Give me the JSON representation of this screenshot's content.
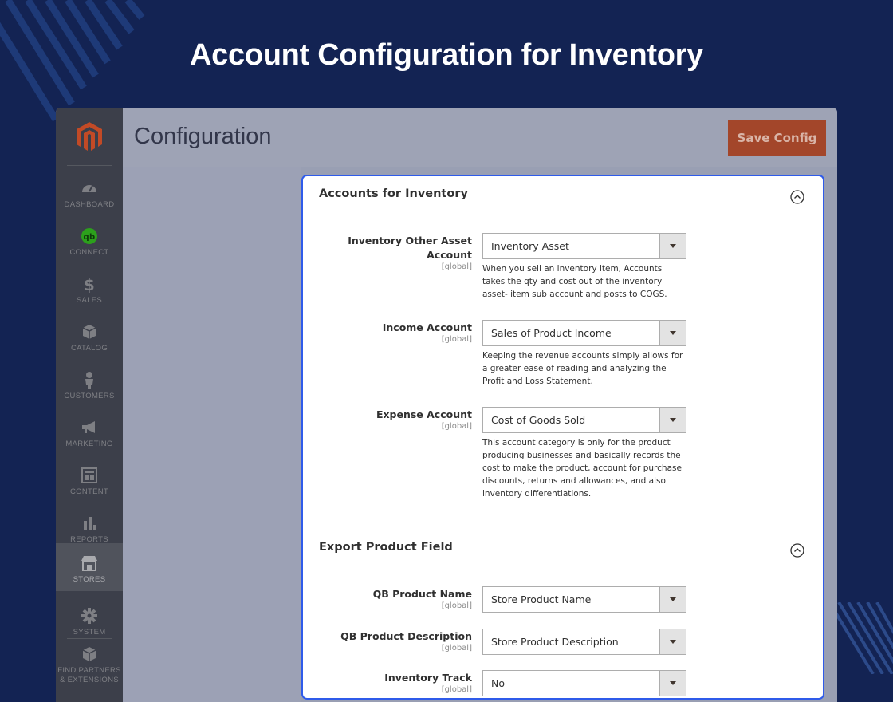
{
  "hero": {
    "title": "Account Configuration for Inventory"
  },
  "colors": {
    "background": "#132353",
    "panel_border": "#2f5bea",
    "save_button": "#a3462a",
    "sidebar": "#3c3f4a"
  },
  "sidebar": {
    "logo": "magento-logo",
    "items": [
      {
        "label": "DASHBOARD",
        "icon": "dashboard-icon",
        "active": false
      },
      {
        "label": "CONNECT",
        "icon": "quickbooks-icon",
        "active": false
      },
      {
        "label": "SALES",
        "icon": "dollar-icon",
        "active": false
      },
      {
        "label": "CATALOG",
        "icon": "box-icon",
        "active": false
      },
      {
        "label": "CUSTOMERS",
        "icon": "person-icon",
        "active": false
      },
      {
        "label": "MARKETING",
        "icon": "megaphone-icon",
        "active": false
      },
      {
        "label": "CONTENT",
        "icon": "layout-icon",
        "active": false
      },
      {
        "label": "REPORTS",
        "icon": "bar-chart-icon",
        "active": false
      },
      {
        "label": "STORES",
        "icon": "storefront-icon",
        "active": true
      },
      {
        "label": "SYSTEM",
        "icon": "gear-icon",
        "active": false
      },
      {
        "label": "FIND PARTNERS",
        "label2": "& EXTENSIONS",
        "icon": "cube-icon",
        "active": false
      }
    ]
  },
  "header": {
    "title": "Configuration",
    "save_label": "Save Config"
  },
  "sections": [
    {
      "title": "Accounts for Inventory",
      "fields": [
        {
          "label_line1": "Inventory Other Asset",
          "label_line2": "Account",
          "scope": "[global]",
          "value": "Inventory Asset",
          "note_lines": [
            "When you sell an inventory item, Accounts",
            "takes the qty and cost out of the inventory",
            "asset- item sub account and posts to COGS."
          ]
        },
        {
          "label_line1": "Income Account",
          "scope": "[global]",
          "value": "Sales of Product Income",
          "note_lines": [
            "Keeping the revenue accounts simply allows for",
            "a greater ease of reading and analyzing the",
            "Profit and Loss Statement."
          ]
        },
        {
          "label_line1": "Expense Account",
          "scope": "[global]",
          "value": "Cost of Goods Sold",
          "note_lines": [
            "This account category is only for the product",
            "producing businesses and basically records the",
            "cost to make the product, account for purchase",
            "discounts, returns and allowances, and also",
            "inventory differentiations."
          ]
        }
      ]
    },
    {
      "title": "Export Product Field",
      "fields": [
        {
          "label_line1": "QB Product Name",
          "scope": "[global]",
          "value": "Store Product Name"
        },
        {
          "label_line1": "QB Product Description",
          "scope": "[global]",
          "value": "Store Product Description"
        },
        {
          "label_line1": "Inventory Track",
          "scope": "[global]",
          "value": "No"
        }
      ]
    }
  ]
}
